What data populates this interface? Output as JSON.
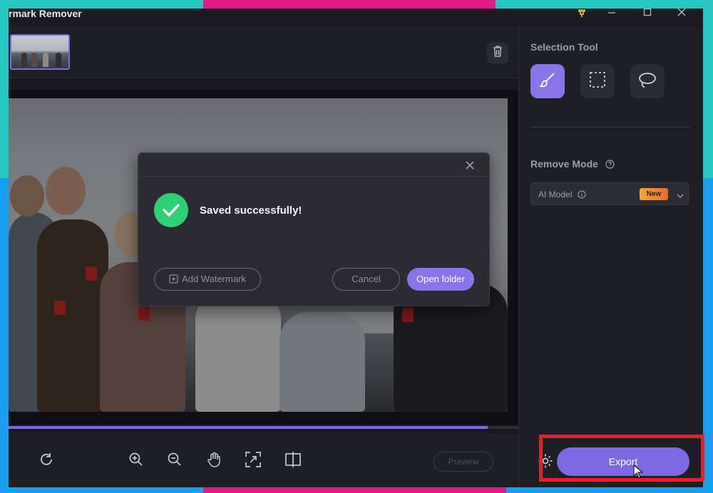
{
  "app": {
    "title": "rmark Remover"
  },
  "window_controls": [
    "pin-icon",
    "minimize-icon",
    "maximize-icon",
    "close-icon"
  ],
  "workspace": {
    "progress": 0.94,
    "toolbar_icons": [
      "rotate-icon",
      "zoom-in-icon",
      "zoom-out-icon",
      "hand-icon",
      "fit-screen-icon",
      "compare-icon"
    ],
    "preview_label": "Preview"
  },
  "panel": {
    "selection_heading": "Selection Tool",
    "tools": [
      "brush-icon",
      "rectangle-select-icon",
      "lasso-icon"
    ],
    "active_tool": "brush-icon",
    "remove_mode_heading": "Remove Mode",
    "mode_value": "AI Model",
    "new_badge": "New",
    "export_label": "Export"
  },
  "dialog": {
    "message": "Saved successfully!",
    "add_watermark_label": "Add Watermark",
    "cancel_label": "Cancel",
    "open_folder_label": "Open folder"
  },
  "colors": {
    "accent": "#7c68e0",
    "success": "#2fcf73",
    "badge": "#f2a83a",
    "highlight": "#e8202a"
  }
}
